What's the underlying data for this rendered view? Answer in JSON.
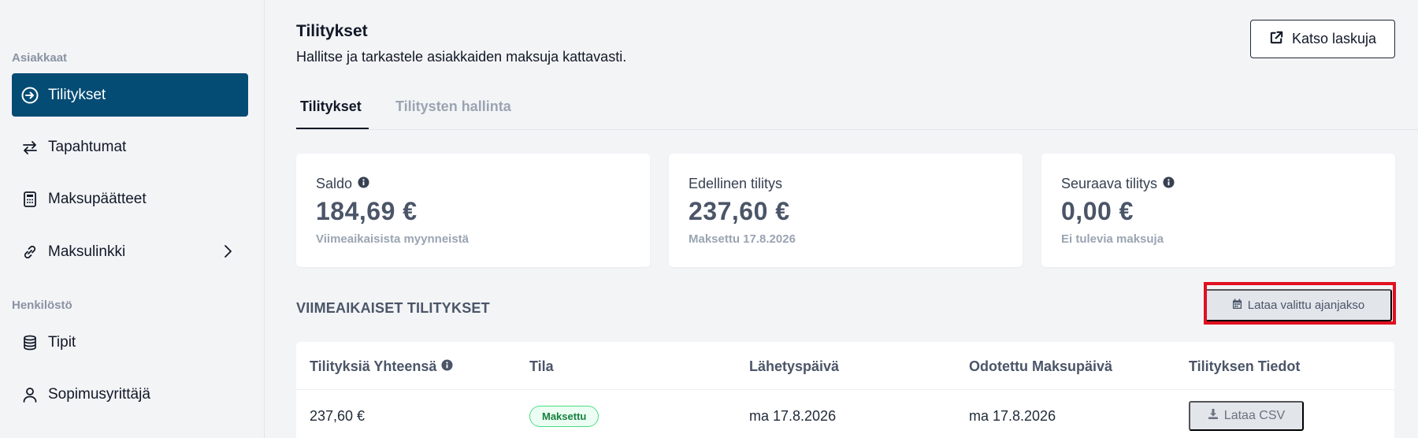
{
  "sidebar": {
    "section_customers": "Asiakkaat",
    "section_staff": "Henkilöstö",
    "items": [
      {
        "label": "Tilitykset",
        "icon": "arrow-circle-right-icon"
      },
      {
        "label": "Tapahtumat",
        "icon": "swap-arrows-icon"
      },
      {
        "label": "Maksupäätteet",
        "icon": "calculator-icon"
      },
      {
        "label": "Maksulinkki",
        "icon": "link-icon"
      },
      {
        "label": "Tipit",
        "icon": "coins-stack-icon"
      },
      {
        "label": "Sopimusyrittäjä",
        "icon": "person-icon"
      }
    ]
  },
  "header": {
    "title": "Tilitykset",
    "subtitle": "Hallitse ja tarkastele asiakkaiden maksuja kattavasti.",
    "invoices_button": "Katso laskuja"
  },
  "tabs": [
    {
      "label": "Tilitykset",
      "active": true
    },
    {
      "label": "Tilitysten hallinta",
      "active": false
    }
  ],
  "cards": [
    {
      "label": "Saldo",
      "value": "184,69 €",
      "note": "Viimeaikaisista myynneistä",
      "info": true
    },
    {
      "label": "Edellinen tilitys",
      "value": "237,60 €",
      "note": "Maksettu 17.8.2026",
      "info": false
    },
    {
      "label": "Seuraava tilitys",
      "value": "0,00 €",
      "note": "Ei tulevia maksuja",
      "info": true
    }
  ],
  "recent": {
    "title": "VIIMEAIKAISET TILITYKSET",
    "download_range_button": "Lataa valittu ajanjakso"
  },
  "table": {
    "columns": [
      "Tilityksiä Yhteensä",
      "Tila",
      "Lähetyspäivä",
      "Odotettu Maksupäivä",
      "Tilityksen Tiedot"
    ],
    "rows": [
      {
        "total": "237,60 €",
        "status": "Maksettu",
        "sent": "ma 17.8.2026",
        "expected": "ma 17.8.2026",
        "details_button": "Lataa CSV"
      }
    ]
  },
  "colors": {
    "active_nav": "#044c74",
    "status_paid": "#15803d",
    "highlight": "#e0101f"
  }
}
